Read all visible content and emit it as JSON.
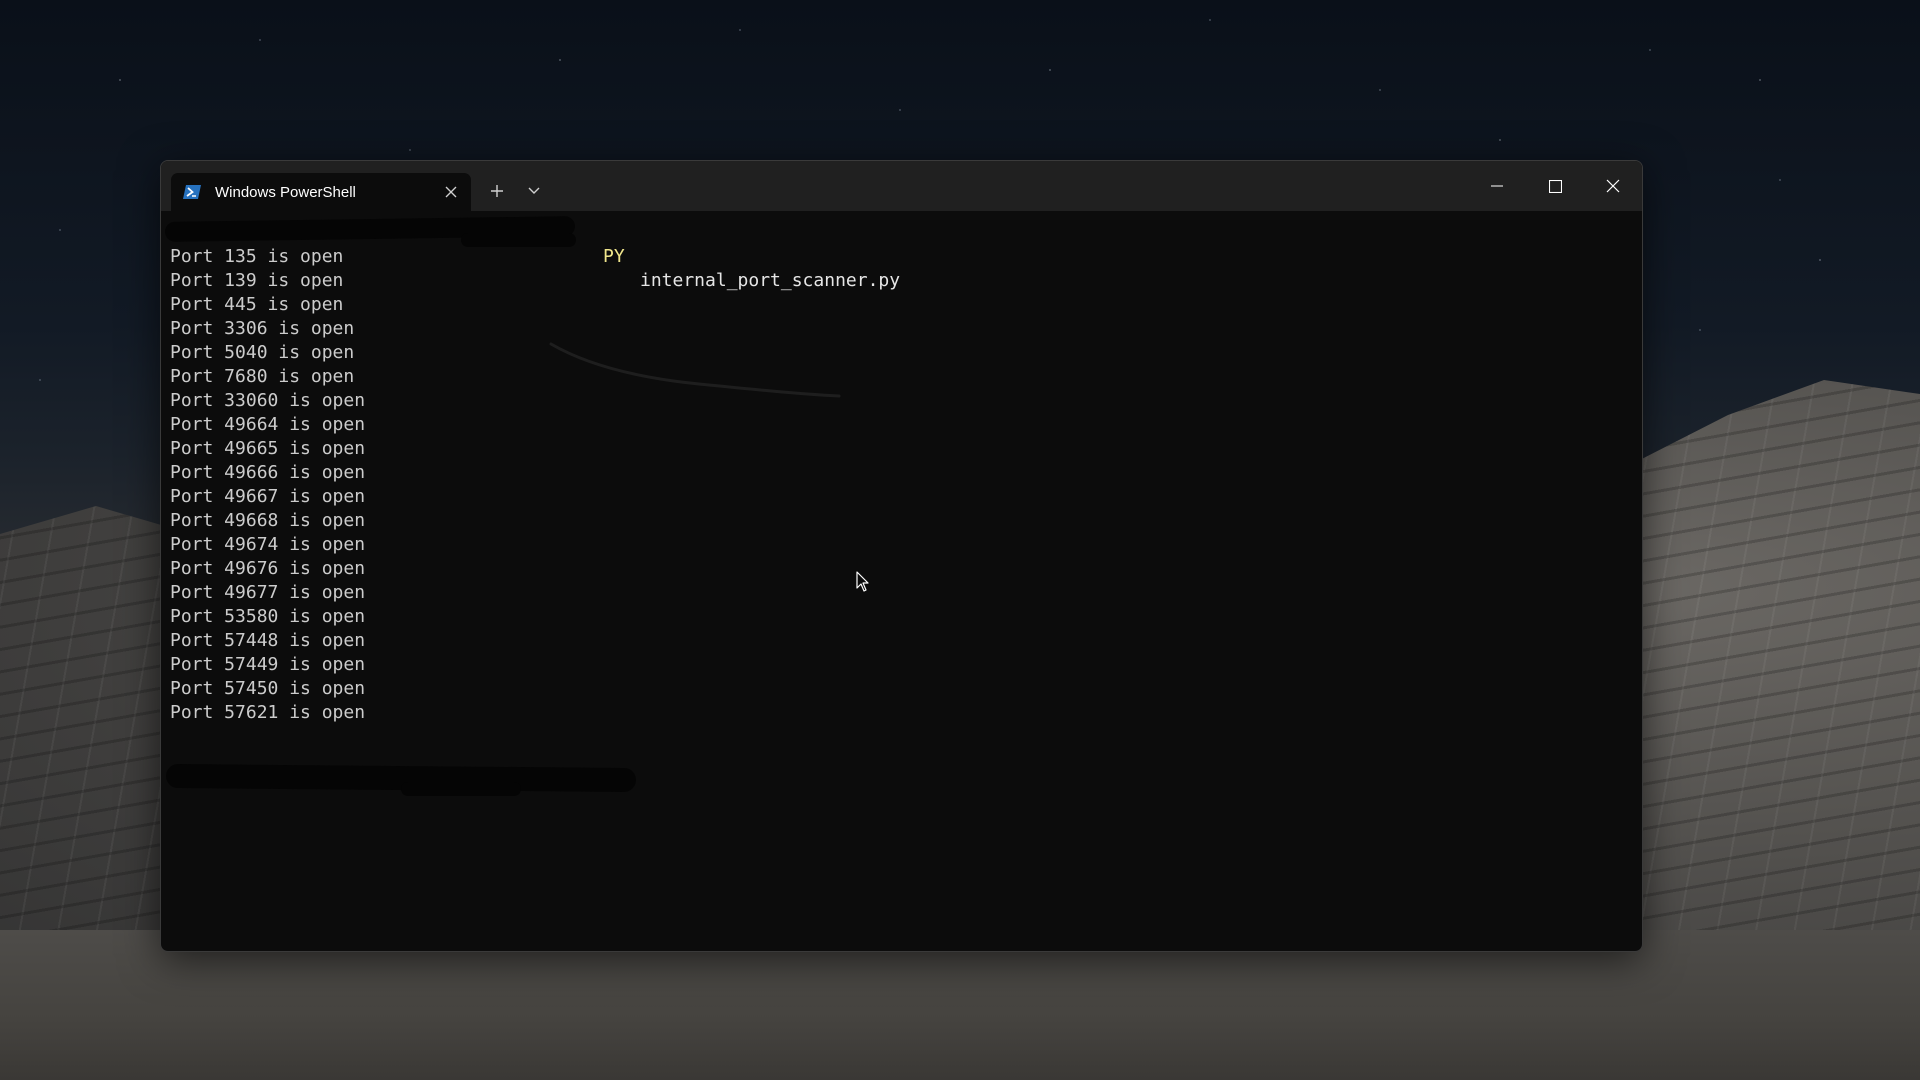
{
  "window": {
    "tab_title": "Windows PowerShell",
    "tab_icon": "powershell-icon",
    "new_tab_icon": "plus-icon",
    "dropdown_icon": "chevron-down-icon",
    "minimize_icon": "minimize-icon",
    "maximize_icon": "maximize-icon",
    "close_icon": "close-icon"
  },
  "terminal": {
    "command_prefix": "PY",
    "command_arg": "internal_port_scanner.py",
    "output": [
      "Port 135 is open",
      "Port 139 is open",
      "Port 445 is open",
      "Port 3306 is open",
      "Port 5040 is open",
      "Port 7680 is open",
      "Port 33060 is open",
      "Port 49664 is open",
      "Port 49665 is open",
      "Port 49666 is open",
      "Port 49667 is open",
      "Port 49668 is open",
      "Port 49674 is open",
      "Port 49676 is open",
      "Port 49677 is open",
      "Port 53580 is open",
      "Port 57448 is open",
      "Port 57449 is open",
      "Port 57450 is open",
      "Port 57621 is open"
    ]
  },
  "colors": {
    "terminal_bg": "#0c0c0c",
    "titlebar_bg": "#202020",
    "text": "#cccccc",
    "command_highlight": "#f0e68c",
    "powershell_blue": "#2671be"
  }
}
